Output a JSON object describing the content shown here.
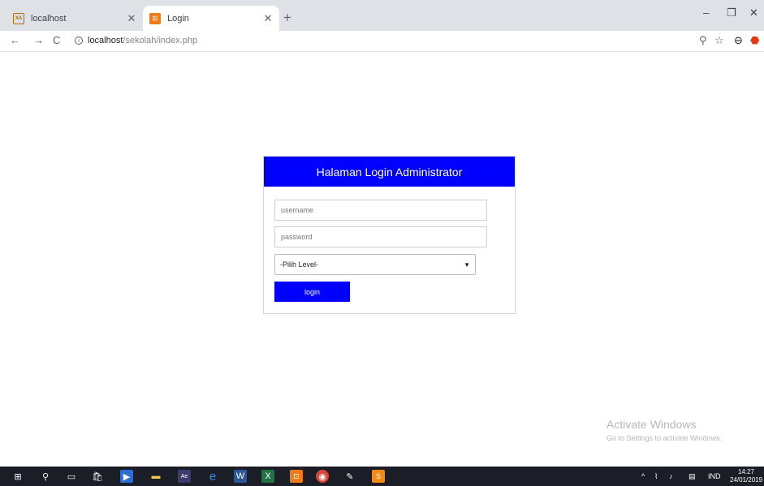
{
  "browser": {
    "tabs": [
      {
        "title": "localhost",
        "favicon": "xampp-icon",
        "active": false
      },
      {
        "title": "Login",
        "favicon": "login-page-icon",
        "active": true
      }
    ],
    "address": {
      "host": "localhost",
      "path": "/sekolah/index.php"
    }
  },
  "login": {
    "header": "Halaman Login Administrator",
    "username_placeholder": "username",
    "password_placeholder": "password",
    "level_selected": "-Pilih Level-",
    "submit_label": "login",
    "accent_color": "#0000ff"
  },
  "watermark": {
    "title": "Activate Windows",
    "subtitle": "Go to Settings to activate Windows."
  },
  "taskbar": {
    "language": "IND",
    "time": "14:27",
    "date": "24/01/2019"
  }
}
